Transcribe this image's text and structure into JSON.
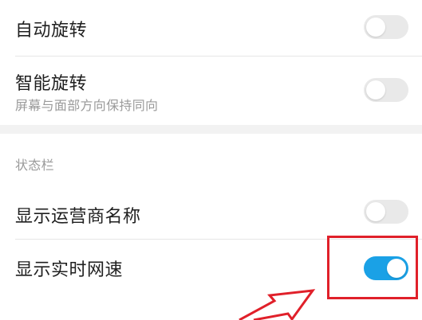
{
  "settings": {
    "auto_rotate": {
      "label": "自动旋转",
      "enabled": false
    },
    "smart_rotate": {
      "label": "智能旋转",
      "description": "屏幕与面部方向保持同向",
      "enabled": false
    },
    "status_bar_section": {
      "header": "状态栏"
    },
    "show_carrier_name": {
      "label": "显示运营商名称",
      "enabled": false
    },
    "show_network_speed": {
      "label": "显示实时网速",
      "enabled": true
    }
  },
  "colors": {
    "toggle_on": "#1aa1e6",
    "toggle_off": "#e9e9e9",
    "annotation": "#e0202a"
  }
}
